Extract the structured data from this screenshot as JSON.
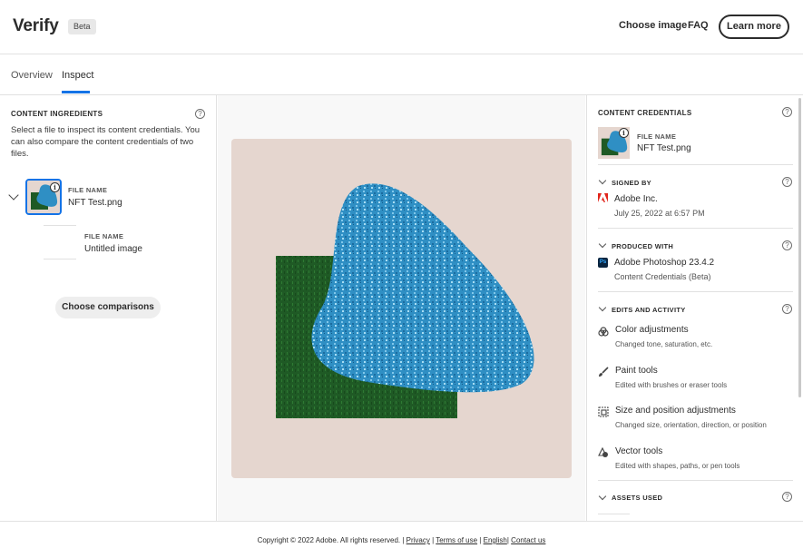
{
  "header": {
    "brand": "Verify",
    "badge": "Beta",
    "nav": {
      "choose_image": "Choose image",
      "faq": "FAQ"
    },
    "learn_more": "Learn more"
  },
  "tabs": [
    {
      "label": "Overview",
      "active": false
    },
    {
      "label": "Inspect",
      "active": true
    }
  ],
  "left_panel": {
    "title": "CONTENT INGREDIENTS",
    "help_icon": "?",
    "description": "Select a file to inspect its content credentials. You can also compare the content credentials of two files.",
    "files": [
      {
        "label": "FILE NAME",
        "name": "NFT Test.png",
        "badge": "i"
      },
      {
        "label": "FILE NAME",
        "name": "Untitled image"
      }
    ],
    "compare_button": "Choose comparisons"
  },
  "right_panel": {
    "credentials": {
      "title": "CONTENT CREDENTIALS",
      "file_label": "FILE NAME",
      "file_name": "NFT Test.png",
      "badge": "i"
    },
    "signed_by": {
      "title": "SIGNED BY",
      "name": "Adobe Inc.",
      "date": "July 25, 2022 at 6:57 PM",
      "icon": "adobe-logo-icon"
    },
    "produced_with": {
      "title": "PRODUCED WITH",
      "app": "Adobe Photoshop 23.4.2",
      "sub": "Content Credentials (Beta)",
      "icon_text": "Ps"
    },
    "edits": {
      "title": "EDITS AND ACTIVITY",
      "items": [
        {
          "name": "Color adjustments",
          "desc": "Changed tone, saturation, etc.",
          "icon": "color-adjust-icon"
        },
        {
          "name": "Paint tools",
          "desc": "Edited with brushes or eraser tools",
          "icon": "brush-icon"
        },
        {
          "name": "Size and position adjustments",
          "desc": "Changed size, orientation, direction, or position",
          "icon": "crop-icon"
        },
        {
          "name": "Vector tools",
          "desc": "Edited with shapes, paths, or pen tools",
          "icon": "shapes-icon"
        }
      ]
    },
    "assets": {
      "title": "ASSETS USED"
    }
  },
  "colors": {
    "accent": "#1473e6",
    "canvas_bg": "#e5d6cf",
    "grass": "#1f5a25",
    "blob": "#2f8fc4"
  },
  "footer": {
    "copyright": "Copyright © 2022 Adobe. All rights reserved.",
    "links": [
      "Privacy",
      "Terms of use",
      "English",
      "Contact us"
    ]
  }
}
